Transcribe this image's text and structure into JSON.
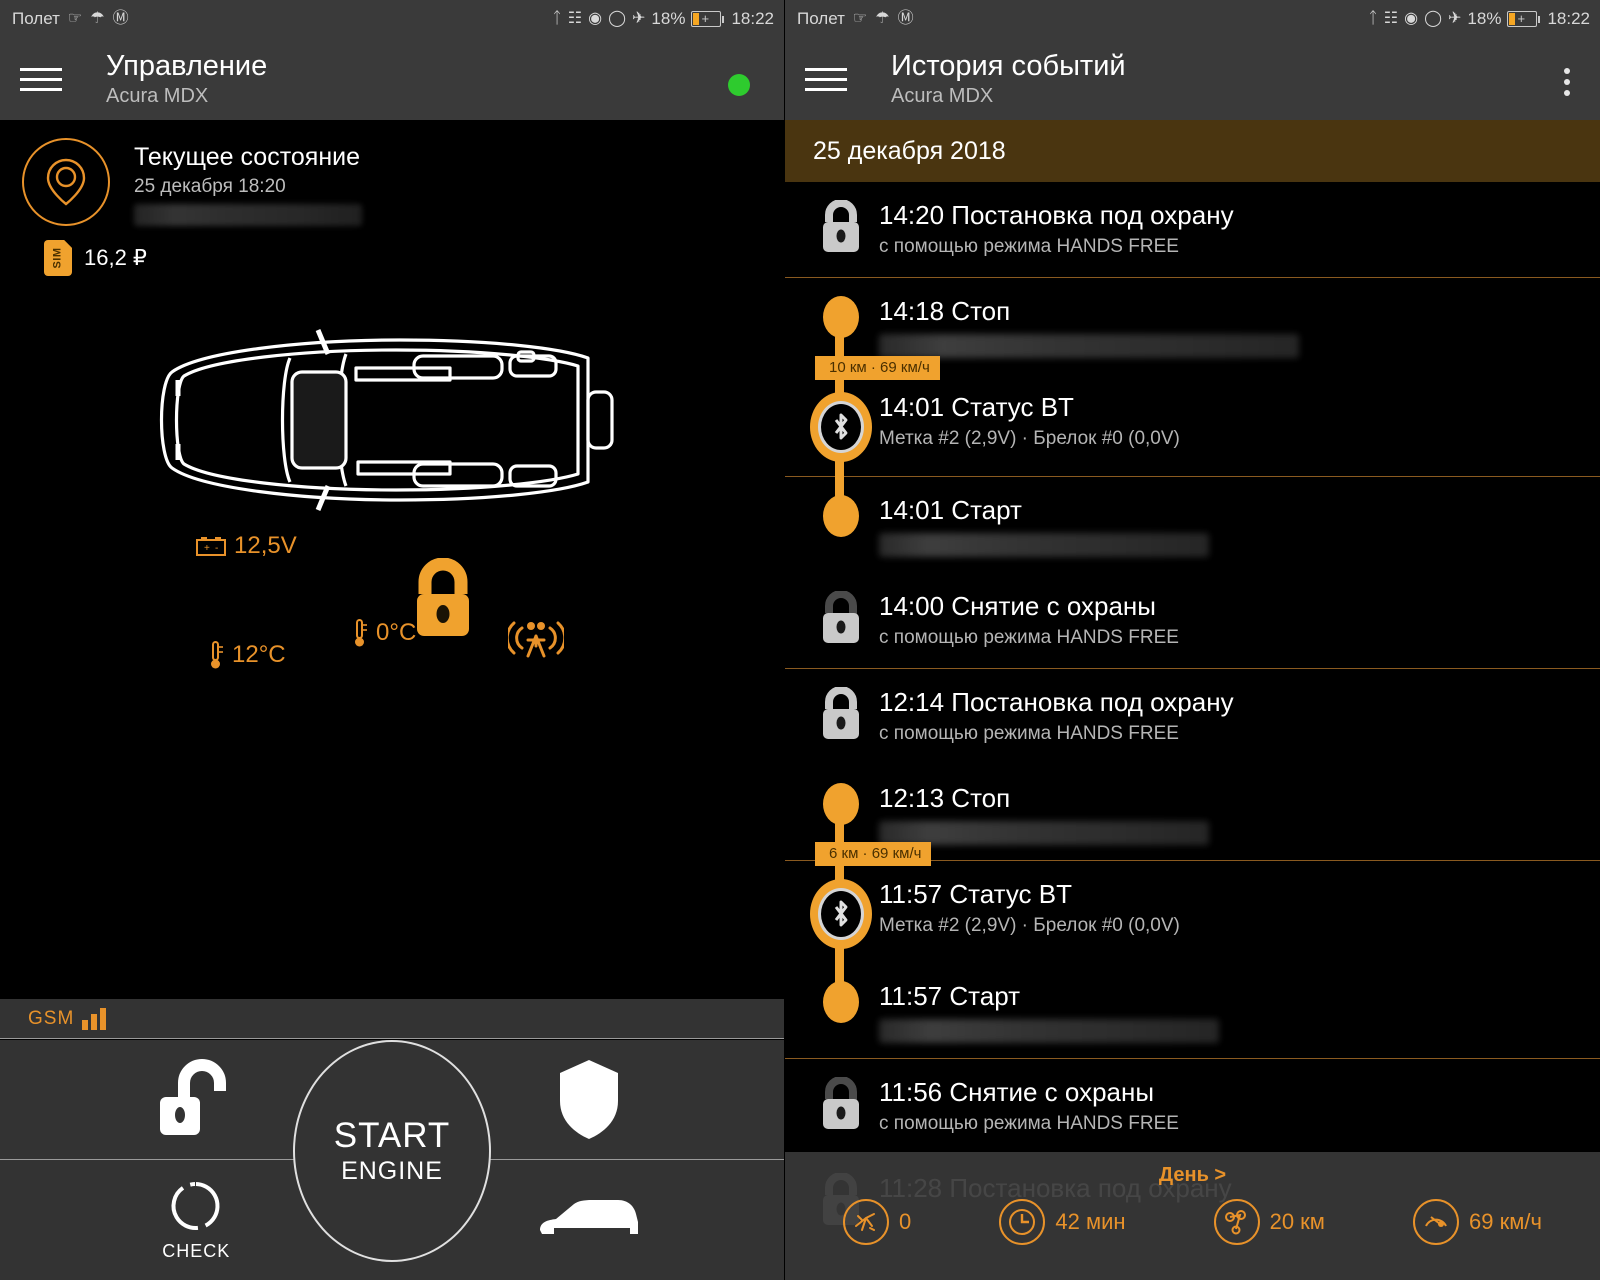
{
  "statusbar": {
    "left_label": "Полет",
    "icons_left": [
      "wifi-off-icon",
      "umbrella-icon",
      "pinterest-icon"
    ],
    "icons_right": [
      "bluetooth-icon",
      "vibrate-icon",
      "eye-alarm-icon",
      "wifi-icon",
      "airplane-icon"
    ],
    "battery_percent": "18%",
    "time": "18:22"
  },
  "left": {
    "appbar": {
      "title": "Управление",
      "subtitle": "Acura MDX",
      "menu_icon": "hamburger-icon",
      "status_dot_color": "#2ecb2e"
    },
    "state": {
      "icon": "location-pin-icon",
      "title": "Текущее состояние",
      "date": "25 декабря 18:20",
      "address_redacted": "",
      "sim_label": "SIM",
      "sim_balance": "16,2 ₽"
    },
    "car": {
      "battery_voltage": "12,5V",
      "temp_outside": "12°C",
      "temp_inside": "0°C",
      "lock_state_icon": "lock-open-icon",
      "shock_sensor_icon": "shock-sensor-icon",
      "battery_icon": "car-battery-icon",
      "thermometer_icon": "thermometer-icon"
    },
    "gsm": {
      "label": "GSM",
      "bars": 3
    },
    "controls": {
      "unlock": {
        "label": "",
        "icon": "unlock-icon"
      },
      "shield": {
        "label": "",
        "icon": "shield-icon"
      },
      "check": {
        "label": "CHECK",
        "icon": "check-circle-icon"
      },
      "trunk": {
        "label": "",
        "icon": "car-side-icon"
      },
      "start_line1": "START",
      "start_line2": "ENGINE"
    }
  },
  "right": {
    "appbar": {
      "title": "История событий",
      "subtitle": "Acura MDX",
      "menu_icon": "hamburger-icon",
      "overflow_icon": "kebab-menu-icon"
    },
    "date_header": "25 декабря 2018",
    "events": [
      {
        "icon": "lock-closed-icon",
        "time": "14:20",
        "title": "Постановка под охрану",
        "sub": "с помощью режима HANDS FREE",
        "type": "lock",
        "redacted": false,
        "separator": true
      },
      {
        "icon": "dot-node-icon",
        "time": "14:18",
        "title": "Стоп",
        "sub": "",
        "type": "stop",
        "redacted": true,
        "badge": "10 км · 69 км/ч",
        "separator": false
      },
      {
        "icon": "bluetooth-node-icon",
        "time": "14:01",
        "title": "Статус BT",
        "sub": "Метка #2 (2,9V)  ·  Брелок #0 (0,0V)",
        "type": "bt",
        "redacted": false,
        "separator": true
      },
      {
        "icon": "dot-node-icon",
        "time": "14:01",
        "title": "Старт",
        "sub": "",
        "type": "start",
        "redacted": true,
        "separator": false
      },
      {
        "icon": "lock-open-icon",
        "time": "14:00",
        "title": "Снятие с охраны",
        "sub": "с помощью режима HANDS FREE",
        "type": "unlock",
        "redacted": false,
        "separator": true
      },
      {
        "icon": "lock-closed-icon",
        "time": "12:14",
        "title": "Постановка под охрану",
        "sub": "с помощью режима HANDS FREE",
        "type": "lock",
        "redacted": false,
        "separator": false
      },
      {
        "icon": "dot-node-icon",
        "time": "12:13",
        "title": "Стоп",
        "sub": "",
        "type": "stop",
        "redacted": true,
        "badge": "6 км · 69 км/ч",
        "separator": true
      },
      {
        "icon": "bluetooth-node-icon",
        "time": "11:57",
        "title": "Статус BT",
        "sub": "Метка #2 (2,9V)  ·  Брелок #0 (0,0V)",
        "type": "bt",
        "redacted": false,
        "separator": false
      },
      {
        "icon": "dot-node-icon",
        "time": "11:57",
        "title": "Старт",
        "sub": "",
        "type": "start",
        "redacted": true,
        "separator": true
      },
      {
        "icon": "lock-open-icon",
        "time": "11:56",
        "title": "Снятие с охраны",
        "sub": "с помощью режима HANDS FREE",
        "type": "unlock",
        "redacted": false,
        "separator": false
      },
      {
        "icon": "lock-closed-icon",
        "time": "11:28",
        "title": "Постановка под охрану",
        "sub": "",
        "type": "lock",
        "redacted": false,
        "separator": false
      }
    ],
    "summary": {
      "day_link": "День >",
      "items": [
        {
          "icon": "alarm-shock-icon",
          "value": "0"
        },
        {
          "icon": "clock-icon",
          "value": "42 мин"
        },
        {
          "icon": "route-icon",
          "value": "20 км"
        },
        {
          "icon": "speedometer-icon",
          "value": "69 км/ч"
        }
      ]
    }
  },
  "colors": {
    "accent": "#f0a22e",
    "accent_dark": "#e8922a",
    "bar": "#3a3a3a",
    "date_header": "#4a3510"
  }
}
